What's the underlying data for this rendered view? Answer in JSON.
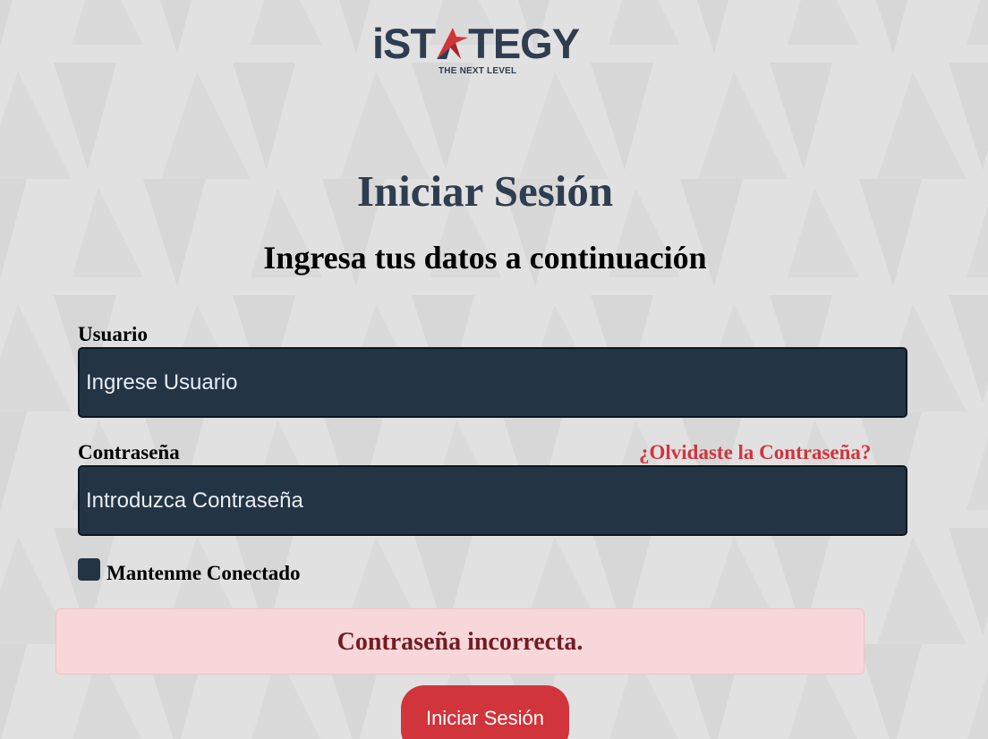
{
  "brand": {
    "wordmark_before": "iST",
    "wordmark_after": "TEGY",
    "tagline": "THE NEXT LEVEL",
    "primary_color": "#2e3d4f",
    "accent_color": "#d1343b",
    "logo_icon": "paper-plane-icon"
  },
  "page": {
    "title": "Iniciar Sesión",
    "subtitle": "Ingresa tus datos a continuación"
  },
  "form": {
    "username": {
      "label": "Usuario",
      "placeholder": "Ingrese Usuario",
      "value": ""
    },
    "password": {
      "label": "Contraseña",
      "placeholder": "Introduzca Contraseña",
      "value": "",
      "forgot_link": "¿Olvidaste la Contraseña?"
    },
    "remember_me": {
      "label": "Mantenme Conectado",
      "checked": false
    },
    "error_message": "Contraseña incorrecta.",
    "submit_label": "Iniciar Sesión"
  }
}
